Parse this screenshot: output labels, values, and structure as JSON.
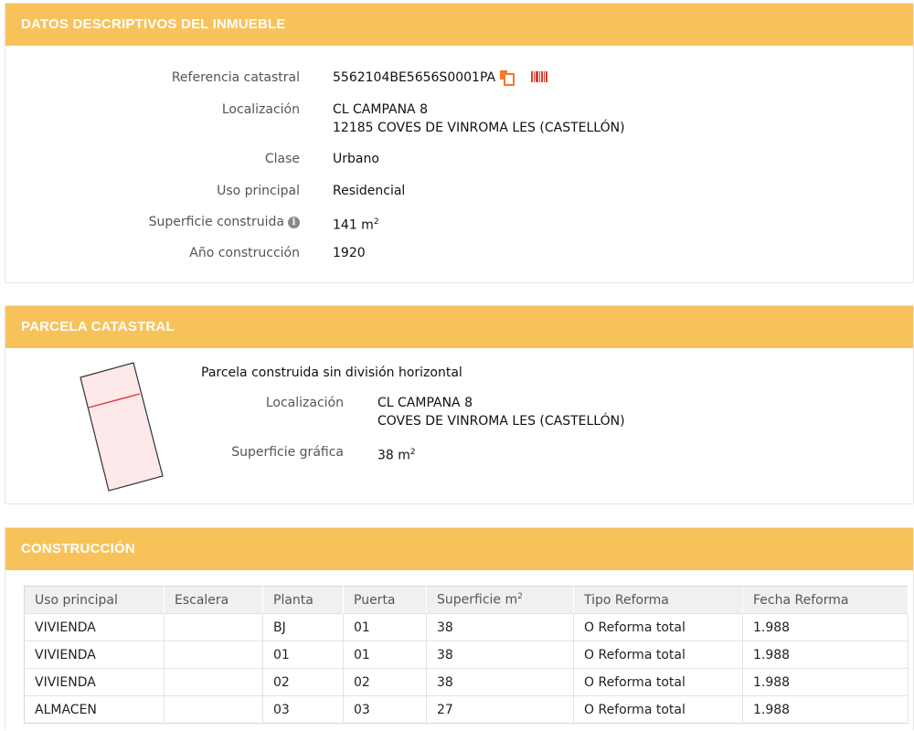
{
  "sections": {
    "datos": {
      "title": "DATOS DESCRIPTIVOS DEL INMUEBLE",
      "ref_label": "Referencia catastral",
      "ref_value": "5562104BE5656S0001PA",
      "loc_label": "Localización",
      "loc_line1": "CL CAMPANA 8",
      "loc_line2": "12185 COVES DE VINROMA LES (CASTELLÓN)",
      "clase_label": "Clase",
      "clase_value": "Urbano",
      "uso_label": "Uso principal",
      "uso_value": "Residencial",
      "sup_label": "Superficie construida",
      "sup_value": "141 m",
      "sup_unit_exp": "2",
      "anio_label": "Año construcción",
      "anio_value": "1920"
    },
    "parcela": {
      "title": "PARCELA CATASTRAL",
      "subtitle": "Parcela construida sin división horizontal",
      "loc_label": "Localización",
      "loc_line1": "CL CAMPANA 8",
      "loc_line2": "COVES DE VINROMA LES (CASTELLÓN)",
      "sup_label": "Superficie gráfica",
      "sup_value": "38 m",
      "sup_unit_exp": "2"
    },
    "construccion": {
      "title": "CONSTRUCCIÓN",
      "headers": [
        "Uso principal",
        "Escalera",
        "Planta",
        "Puerta",
        "Superficie m",
        "Tipo Reforma",
        "Fecha Reforma"
      ],
      "sup_header_exp": "2",
      "rows": [
        [
          "VIVIENDA",
          "",
          "BJ",
          "01",
          "38",
          "O Reforma total",
          "1.988"
        ],
        [
          "VIVIENDA",
          "",
          "01",
          "01",
          "38",
          "O Reforma total",
          "1.988"
        ],
        [
          "VIVIENDA",
          "",
          "02",
          "02",
          "38",
          "O Reforma total",
          "1.988"
        ],
        [
          "ALMACEN",
          "",
          "03",
          "03",
          "27",
          "O Reforma total",
          "1.988"
        ]
      ]
    }
  },
  "icons": {
    "info": "info-icon",
    "copy": "copy-icon",
    "barcode": "barcode-icon"
  },
  "colors": {
    "header_bg": "#f8c25b",
    "accent_orange": "#f27a2c",
    "parcel_outline": "#333333",
    "parcel_fill": "#fde8ea",
    "parcel_divider": "#e0323a"
  }
}
